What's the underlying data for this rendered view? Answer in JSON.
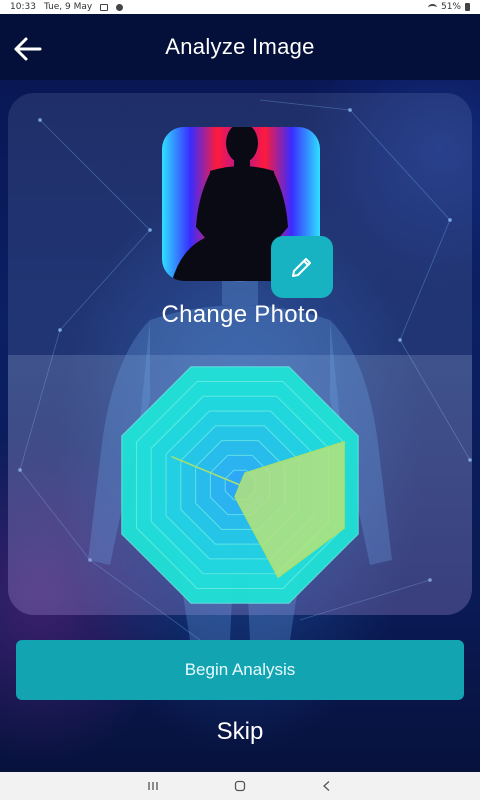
{
  "status_bar": {
    "time": "10:33",
    "date": "Tue, 9 May",
    "battery": "51%"
  },
  "app_bar": {
    "title": "Analyze Image",
    "back_icon": "arrow-left-icon"
  },
  "photo_card": {
    "edit_icon": "pencil-icon",
    "change_photo_label": "Change Photo"
  },
  "chart_data": {
    "type": "radar",
    "axes_count": 8,
    "rings": 8,
    "max": 10,
    "series": [
      {
        "values": [
          1,
          8.8,
          8.8,
          7.8,
          1,
          0,
          5.8,
          0
        ]
      }
    ],
    "colors": {
      "grid": "#2fe0d8",
      "fill": "#b7e37a"
    }
  },
  "actions": {
    "begin_label": "Begin Analysis",
    "skip_label": "Skip"
  },
  "nav_bar": {
    "recent_icon": "recent-apps-icon",
    "home_icon": "home-icon",
    "back_icon": "back-triangle-icon"
  },
  "colors": {
    "accent": "#13a4b1",
    "background": "#0b1f63"
  }
}
